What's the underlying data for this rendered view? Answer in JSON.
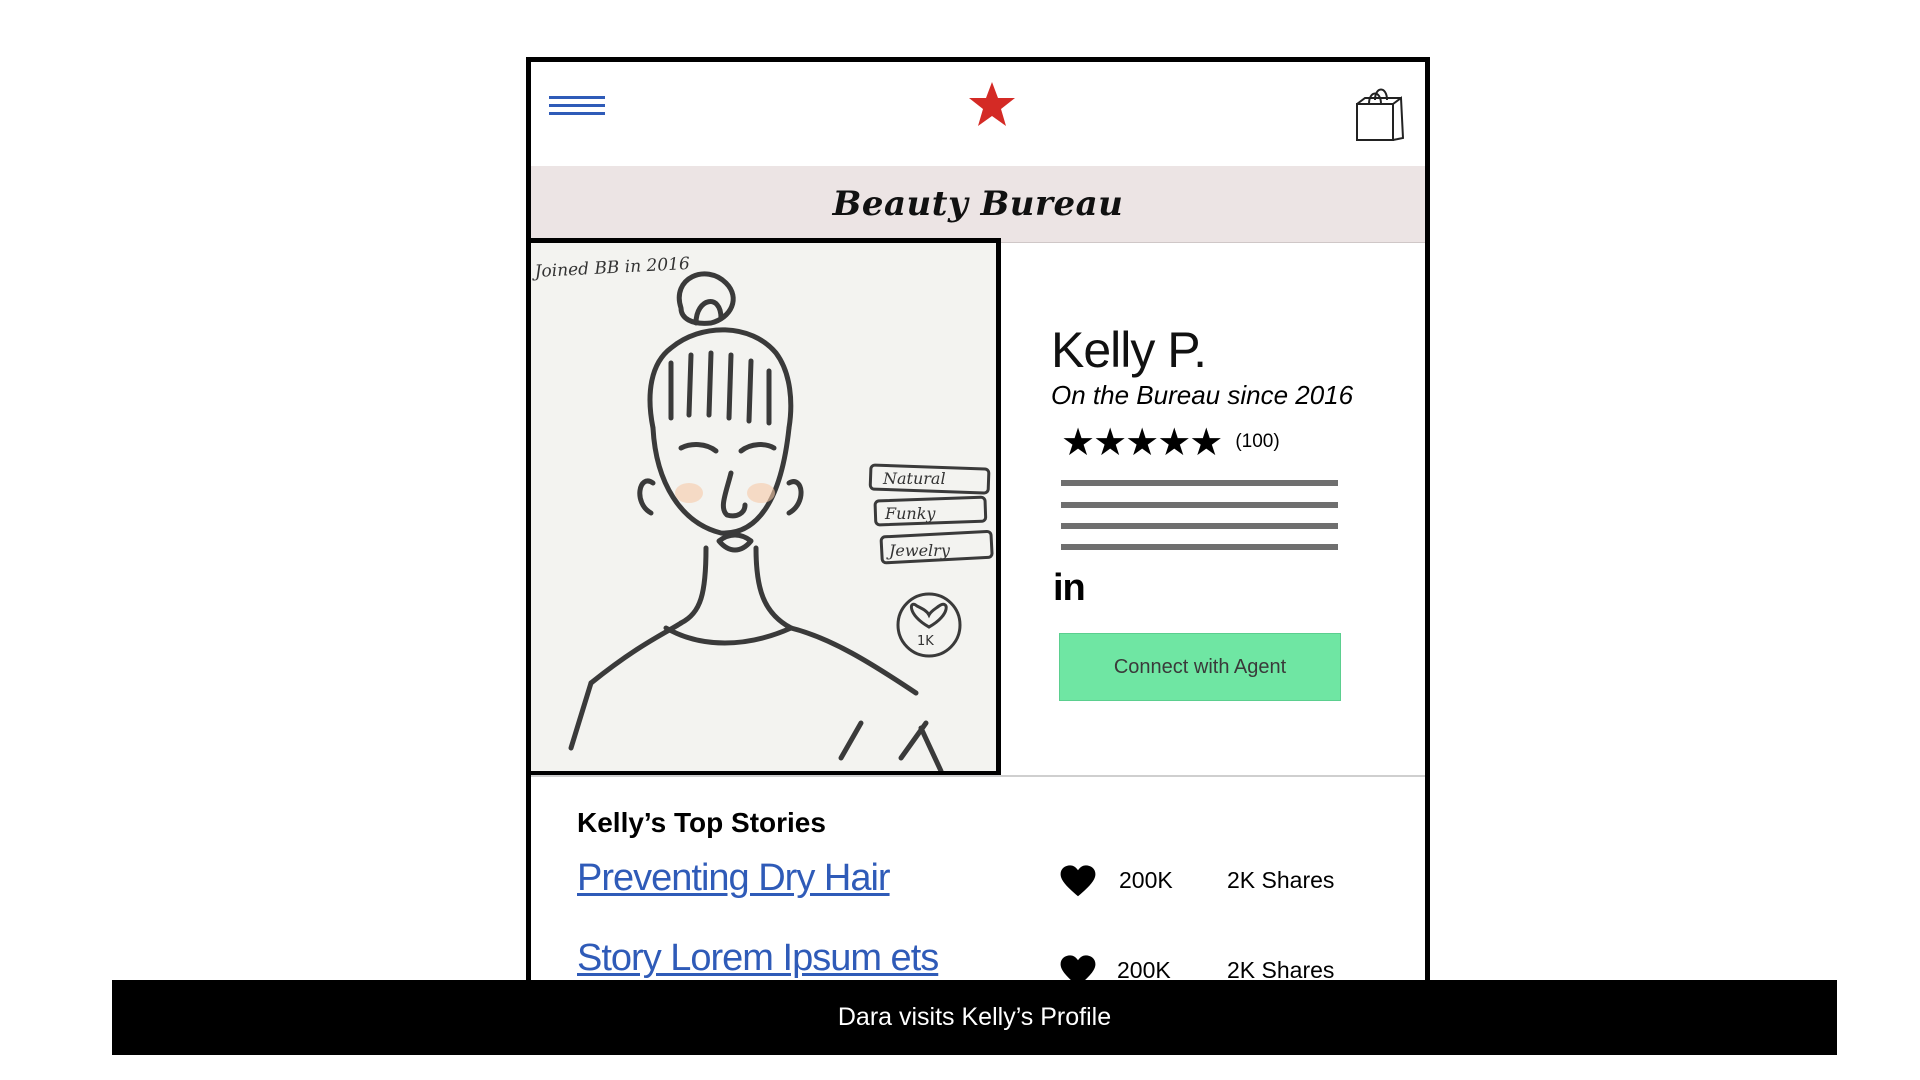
{
  "header": {
    "menu_icon": "hamburger-menu-icon",
    "brand_icon": "red-star-logo",
    "bag_icon": "shopping-bag-icon",
    "brand_color": "#d42a25",
    "menu_color": "#2f5bb8"
  },
  "title_band": {
    "title": "Beauty Bureau",
    "background": "#ece4e4"
  },
  "portrait": {
    "note": "Joined BB in 2016",
    "tags": [
      "Natural",
      "Funky",
      "Jewelry"
    ],
    "likes_badge": "1K"
  },
  "profile": {
    "name": "Kelly P.",
    "since": "On the Bureau since 2016",
    "rating": 5,
    "rating_count": "(100)",
    "linkedin_label": "in",
    "connect_label": "Connect with Agent",
    "connect_color": "#6fe6a3"
  },
  "stories": {
    "title": "Kelly’s Top Stories",
    "items": [
      {
        "title": "Preventing Dry Hair",
        "likes": "200K",
        "shares": "2K Shares"
      },
      {
        "title": "Story Lorem Ipsum ets",
        "likes": "200K",
        "shares": "2K Shares"
      }
    ]
  },
  "caption": "Dara visits Kelly’s Profile"
}
